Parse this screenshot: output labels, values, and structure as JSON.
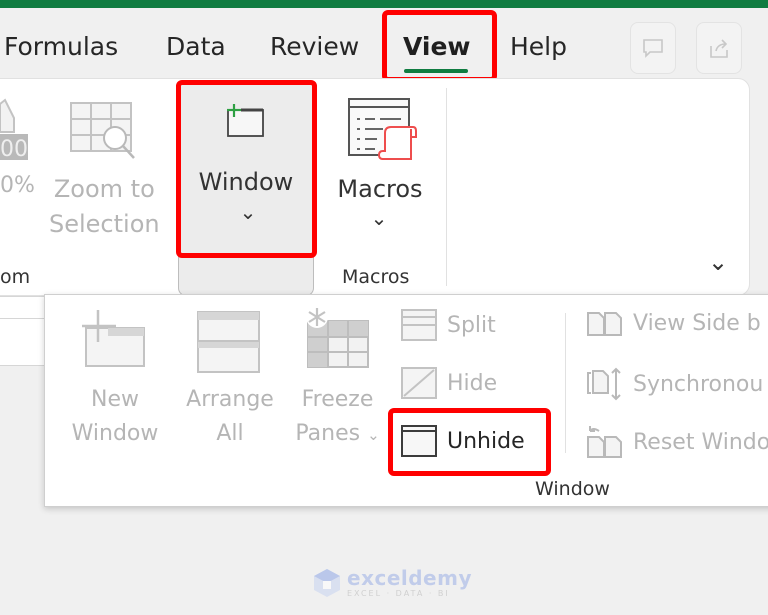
{
  "ribbon_tabs": [
    {
      "label": "Formulas",
      "active": false
    },
    {
      "label": "Data",
      "active": false
    },
    {
      "label": "Review",
      "active": false
    },
    {
      "label": "View",
      "active": true
    },
    {
      "label": "Help",
      "active": false
    }
  ],
  "top_right": {
    "comments_icon": "comment-icon",
    "share_icon": "share-icon"
  },
  "ribbon": {
    "zoom_group": {
      "zoom_100_label_partial": "0%",
      "zoom_100_icon_text": "00",
      "zoom_to_selection": [
        "Zoom to",
        "Selection"
      ],
      "group_label_partial": "om"
    },
    "window_button": {
      "label": "Window",
      "chevron": "⌄"
    },
    "macros_button": {
      "label": "Macros",
      "chevron": "⌄"
    },
    "macros_group_label": "Macros",
    "collapse_chevron": "⌄"
  },
  "window_popup": {
    "large_buttons": [
      {
        "line1": "New",
        "line2": "Window",
        "enabled": false
      },
      {
        "line1": "Arrange",
        "line2": "All",
        "enabled": false
      },
      {
        "line1": "Freeze",
        "line2": "Panes",
        "enabled": false,
        "has_dropdown": true
      }
    ],
    "small_buttons_col1": [
      {
        "label": "Split",
        "enabled": false
      },
      {
        "label": "Hide",
        "enabled": false
      },
      {
        "label": "Unhide",
        "enabled": true,
        "highlighted": true
      }
    ],
    "small_buttons_col2": [
      {
        "label": "View Side b",
        "enabled": false
      },
      {
        "label": "Synchronou",
        "enabled": false
      },
      {
        "label": "Reset Windo",
        "enabled": false
      }
    ],
    "group_label": "Window",
    "freeze_chevron": "⌄"
  },
  "watermark": {
    "name": "exceldemy",
    "tagline": "EXCEL · DATA · BI"
  },
  "colors": {
    "excel_green": "#107c41",
    "highlight_red": "#ff0000",
    "disabled_text": "#b5b5b5"
  }
}
